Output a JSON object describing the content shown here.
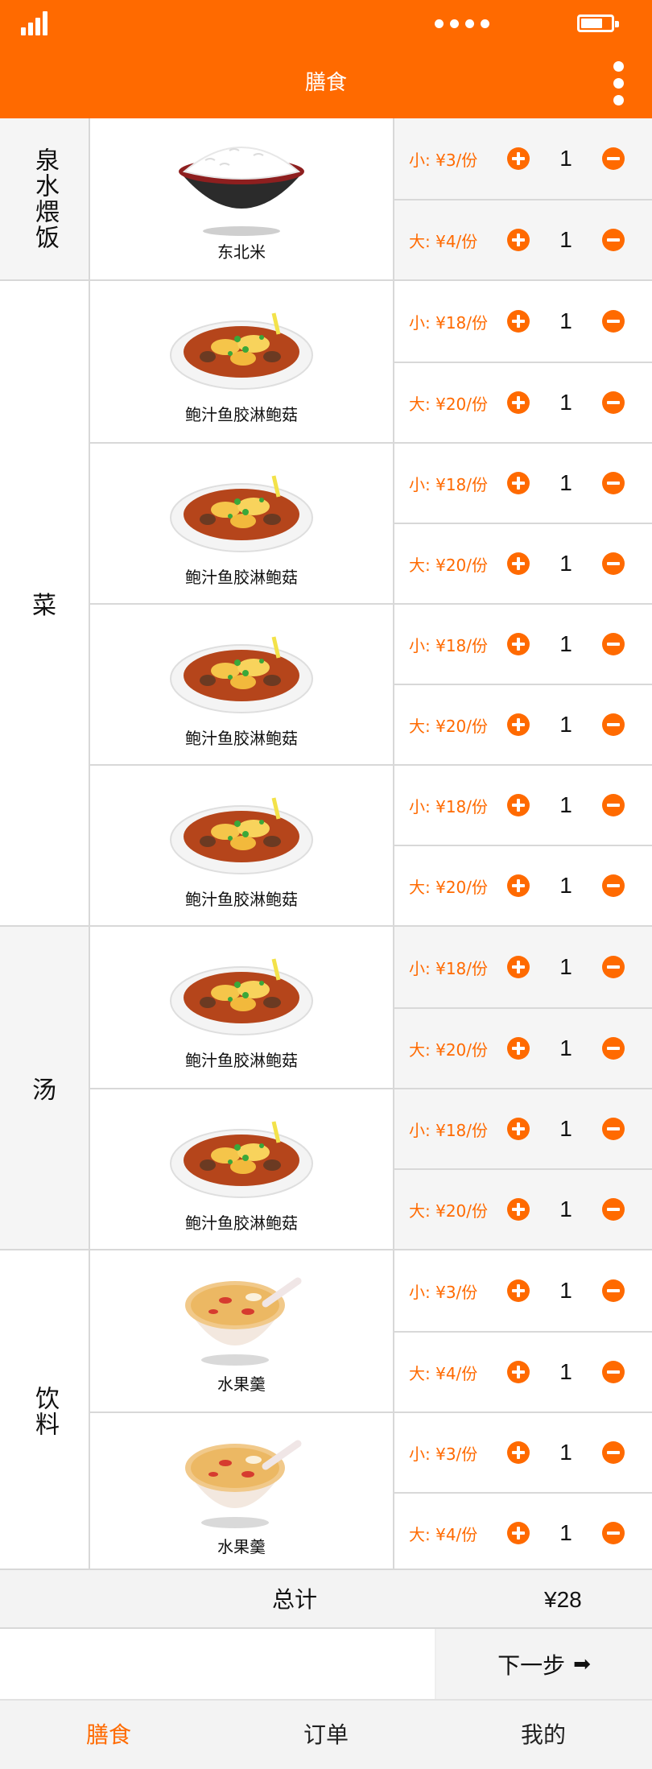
{
  "header": {
    "title": "膳食"
  },
  "colors": {
    "accent": "#ff6a00",
    "shaded_bg": "#f5f5f5"
  },
  "categories": [
    {
      "name": "泉水煨饭"
    },
    {
      "name": "菜"
    },
    {
      "name": "汤"
    },
    {
      "name": "饮料"
    }
  ],
  "items": [
    {
      "name": "东北米",
      "image": "rice-bowl",
      "options": [
        {
          "price": "小: ¥3/份",
          "qty": "1"
        },
        {
          "price": "大: ¥4/份",
          "qty": "1"
        }
      ]
    },
    {
      "name": "鲍汁鱼胶淋鲍菇",
      "image": "braised-dish",
      "options": [
        {
          "price": "小: ¥18/份",
          "qty": "1"
        },
        {
          "price": "大: ¥20/份",
          "qty": "1"
        }
      ]
    },
    {
      "name": "鲍汁鱼胶淋鲍菇",
      "image": "braised-dish",
      "options": [
        {
          "price": "小: ¥18/份",
          "qty": "1"
        },
        {
          "price": "大: ¥20/份",
          "qty": "1"
        }
      ]
    },
    {
      "name": "鲍汁鱼胶淋鲍菇",
      "image": "braised-dish",
      "options": [
        {
          "price": "小: ¥18/份",
          "qty": "1"
        },
        {
          "price": "大: ¥20/份",
          "qty": "1"
        }
      ]
    },
    {
      "name": "鲍汁鱼胶淋鲍菇",
      "image": "braised-dish",
      "options": [
        {
          "price": "小: ¥18/份",
          "qty": "1"
        },
        {
          "price": "大: ¥20/份",
          "qty": "1"
        }
      ]
    },
    {
      "name": "鲍汁鱼胶淋鲍菇",
      "image": "braised-dish",
      "options": [
        {
          "price": "小: ¥18/份",
          "qty": "1"
        },
        {
          "price": "大: ¥20/份",
          "qty": "1"
        }
      ]
    },
    {
      "name": "鲍汁鱼胶淋鲍菇",
      "image": "braised-dish",
      "options": [
        {
          "price": "小: ¥18/份",
          "qty": "1"
        },
        {
          "price": "大: ¥20/份",
          "qty": "1"
        }
      ]
    },
    {
      "name": "水果羹",
      "image": "fruit-soup-bowl",
      "options": [
        {
          "price": "小: ¥3/份",
          "qty": "1"
        },
        {
          "price": "大: ¥4/份",
          "qty": "1"
        }
      ]
    },
    {
      "name": "水果羹",
      "image": "fruit-soup-bowl",
      "options": [
        {
          "price": "小: ¥3/份",
          "qty": "1"
        },
        {
          "price": "大: ¥4/份",
          "qty": "1"
        }
      ]
    }
  ],
  "total": {
    "label": "总计",
    "value": "¥28"
  },
  "next": {
    "label": "下一步"
  },
  "tabs": [
    {
      "label": "膳食",
      "active": true
    },
    {
      "label": "订单",
      "active": false
    },
    {
      "label": "我的",
      "active": false
    }
  ]
}
